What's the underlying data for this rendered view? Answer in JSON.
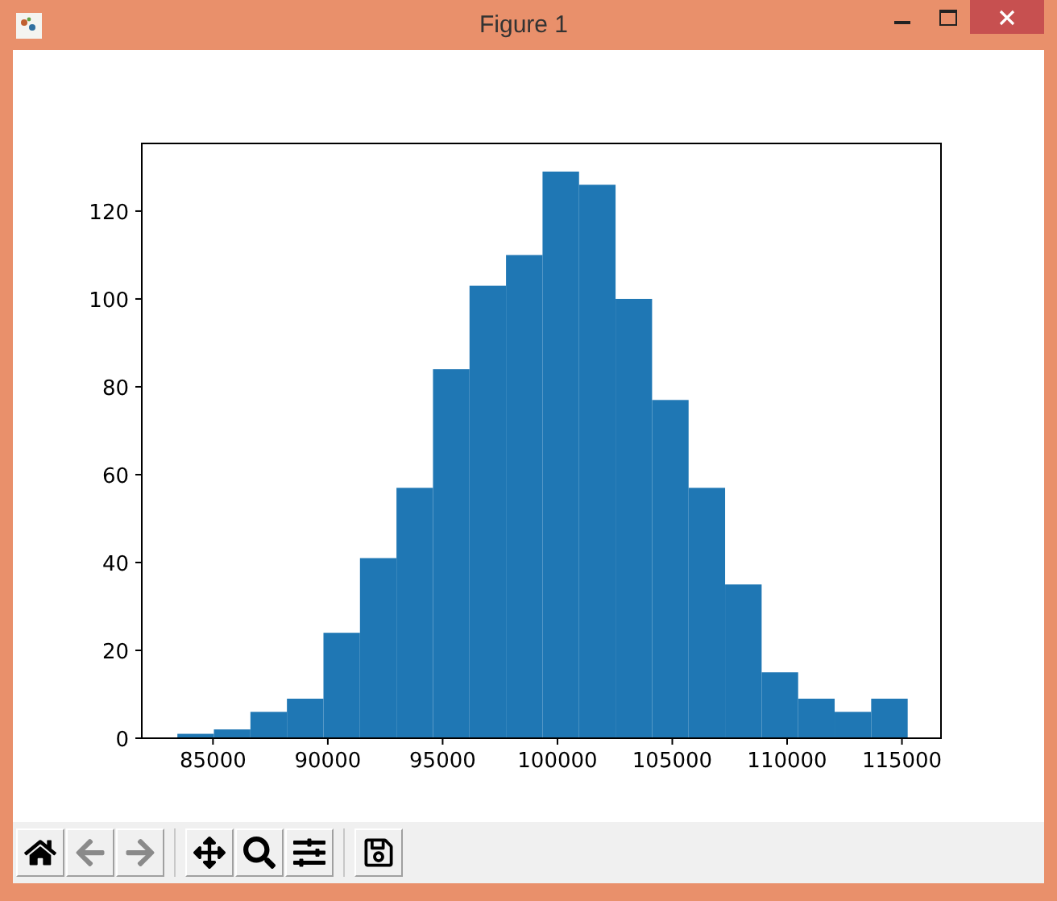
{
  "window": {
    "title": "Figure 1"
  },
  "chart_data": {
    "type": "bar",
    "x": [
      84245,
      85835,
      87425,
      89015,
      90605,
      92195,
      93785,
      95375,
      96965,
      98555,
      100145,
      101735,
      103325,
      104915,
      106505,
      108095,
      109685,
      111275,
      112865,
      114455
    ],
    "values": [
      1,
      2,
      6,
      9,
      24,
      41,
      57,
      84,
      103,
      110,
      129,
      126,
      100,
      77,
      57,
      35,
      15,
      9,
      6,
      9
    ],
    "color": "#1f77b4",
    "xlim": [
      81900,
      116700
    ],
    "ylim": [
      0,
      135.4
    ],
    "xticks": [
      85000,
      90000,
      95000,
      100000,
      105000,
      110000,
      115000
    ],
    "yticks": [
      0,
      20,
      40,
      60,
      80,
      100,
      120
    ]
  },
  "toolbar": [
    {
      "kind": "home",
      "disabled": false
    },
    {
      "kind": "back",
      "disabled": true
    },
    {
      "kind": "forward",
      "disabled": true
    },
    {
      "kind": "separator"
    },
    {
      "kind": "pan",
      "disabled": false
    },
    {
      "kind": "zoom",
      "disabled": false
    },
    {
      "kind": "configure",
      "disabled": false
    },
    {
      "kind": "separator"
    },
    {
      "kind": "save",
      "disabled": false
    }
  ]
}
